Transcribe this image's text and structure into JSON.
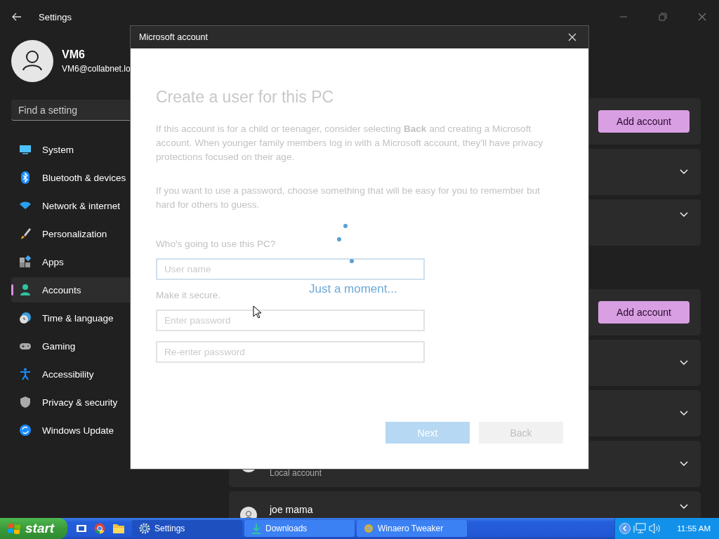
{
  "window": {
    "title": "Settings"
  },
  "profile": {
    "name": "VM6",
    "email": "VM6@collabnet.lo"
  },
  "search": {
    "placeholder": "Find a setting"
  },
  "nav": [
    {
      "label": "System",
      "selected": false
    },
    {
      "label": "Bluetooth & devices",
      "selected": false
    },
    {
      "label": "Network & internet",
      "selected": false
    },
    {
      "label": "Personalization",
      "selected": false
    },
    {
      "label": "Apps",
      "selected": false
    },
    {
      "label": "Accounts",
      "selected": true
    },
    {
      "label": "Time & language",
      "selected": false
    },
    {
      "label": "Gaming",
      "selected": false
    },
    {
      "label": "Accessibility",
      "selected": false
    },
    {
      "label": "Privacy & security",
      "selected": false
    },
    {
      "label": "Windows Update",
      "selected": false
    }
  ],
  "sections": [
    {
      "cards": [
        {
          "kind": "action",
          "button": "Add account"
        },
        {
          "kind": "expander"
        },
        {
          "kind": "expander"
        }
      ]
    },
    {
      "cards": [
        {
          "kind": "action",
          "button": "Add account"
        },
        {
          "kind": "expander"
        },
        {
          "kind": "expander"
        },
        {
          "kind": "account",
          "subtitle": "Local account"
        },
        {
          "kind": "account",
          "title": "joe mama"
        }
      ]
    }
  ],
  "dialog": {
    "title": "Microsoft account",
    "heading": "Create a user for this PC",
    "paragraphs": [
      "If this account is for a child or teenager, consider selecting **Back** and creating a Microsoft account. When younger family members log in with a Microsoft account, they'll have privacy protections focused on their age.",
      "If you want to use a password, choose something that will be easy for you to remember but hard for others to guess."
    ],
    "question": "Who's going to use this PC?",
    "username_placeholder": "User name",
    "secure_label": "Make it secure.",
    "password_placeholder": "Enter password",
    "confirm_placeholder": "Re-enter password",
    "loading": "Just a moment...",
    "buttons": [
      {
        "label": "Next",
        "kind": "primary"
      },
      {
        "label": "Back",
        "kind": "secondary"
      }
    ]
  },
  "taskbar": {
    "start": "start",
    "tasks": [
      {
        "label": "Settings",
        "selected": true
      },
      {
        "label": "Downloads",
        "selected": false
      },
      {
        "label": "Winaero Tweaker",
        "selected": false
      }
    ],
    "clock": "11:55 AM"
  }
}
